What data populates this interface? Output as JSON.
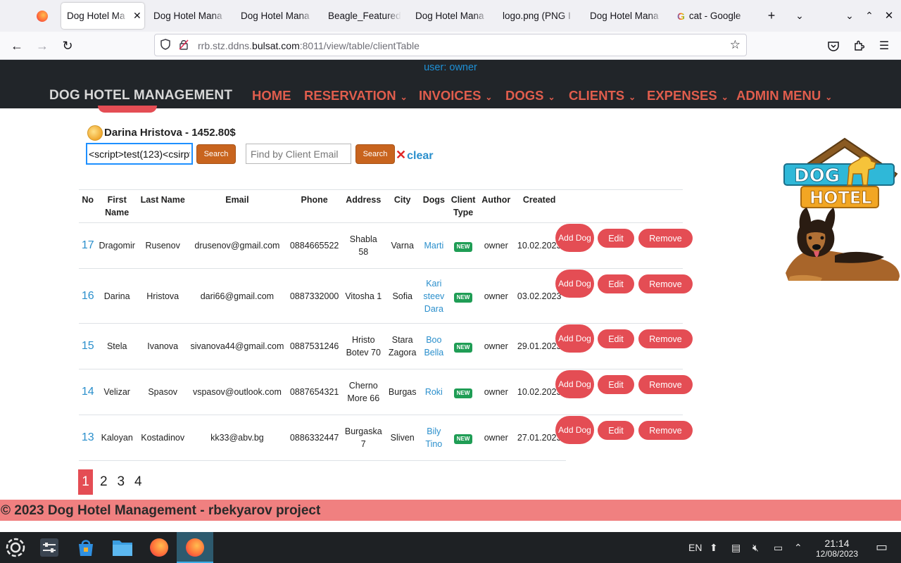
{
  "browser": {
    "tabs": [
      {
        "label": "Dog Hotel Ma",
        "active": true
      },
      {
        "label": "Dog Hotel Mana"
      },
      {
        "label": "Dog Hotel Mana"
      },
      {
        "label": "Beagle_Featured"
      },
      {
        "label": "Dog Hotel Mana"
      },
      {
        "label": "logo.png (PNG I"
      },
      {
        "label": "Dog Hotel Mana"
      },
      {
        "label": "cat - Google"
      }
    ],
    "url_prefix": "rrb.stz.ddns.",
    "url_domain": "bulsat.com",
    "url_suffix": ":8011/view/table/clientTable"
  },
  "header": {
    "user_line": "user: owner",
    "brand": "DOG HOTEL MANAGEMENT",
    "menu": {
      "home": "HOME",
      "reservation": "RESERVATION",
      "invoices": "INVOICES",
      "dogs": "DOGS",
      "clients": "CLIENTS",
      "expenses": "EXPENSES",
      "admin": "ADMIN MENU"
    },
    "accent_color": "#e05d4d"
  },
  "main": {
    "client_title": "Darina Hristova - 1452.80$",
    "search_value": "<script>test(123)<csirpt",
    "search_button": "Search",
    "email_placeholder": "Find by Client Email",
    "search_button2": "Search",
    "clear_x": "✕",
    "clear_label": "clear"
  },
  "table": {
    "headers": {
      "no": "No",
      "first_name": "First Name",
      "last_name": "Last Name",
      "email": "Email",
      "phone": "Phone",
      "address": "Address",
      "city": "City",
      "dogs": "Dogs",
      "client_type": "Client Type",
      "author": "Author",
      "created": "Created"
    },
    "rows": [
      {
        "no": "17",
        "first": "Dragomir",
        "last": "Rusenov",
        "email": "drusenov@gmail.com",
        "phone": "0884665522",
        "address": "Shabla 58",
        "city": "Varna",
        "dog1": "Marti",
        "dog2": "",
        "dog3": "",
        "type": "NEW",
        "author": "owner",
        "created": "10.02.2023"
      },
      {
        "no": "16",
        "first": "Darina",
        "last": "Hristova",
        "email": "dari66@gmail.com",
        "phone": "0887332000",
        "address": "Vitosha 1",
        "city": "Sofia",
        "dog1": "Kari",
        "dog2": "steev",
        "dog3": "Dara",
        "type": "NEW",
        "author": "owner",
        "created": "03.02.2023"
      },
      {
        "no": "15",
        "first": "Stela",
        "last": "Ivanova",
        "email": "sivanova44@gmail.com",
        "phone": "0887531246",
        "address": "Hristo Botev 70",
        "city": "Stara Zagora",
        "dog1": "Boo",
        "dog2": "Bella",
        "dog3": "",
        "type": "NEW",
        "author": "owner",
        "created": "29.01.2023"
      },
      {
        "no": "14",
        "first": "Velizar",
        "last": "Spasov",
        "email": "vspasov@outlook.com",
        "phone": "0887654321",
        "address": "Cherno More 66",
        "city": "Burgas",
        "dog1": "Roki",
        "dog2": "",
        "dog3": "",
        "type": "NEW",
        "author": "owner",
        "created": "10.02.2023"
      },
      {
        "no": "13",
        "first": "Kaloyan",
        "last": "Kostadinov",
        "email": "kk33@abv.bg",
        "phone": "0886332447",
        "address": "Burgaska 7",
        "city": "Sliven",
        "dog1": "Bily",
        "dog2": "Tino",
        "dog3": "",
        "type": "NEW",
        "author": "owner",
        "created": "27.01.2023"
      }
    ],
    "actions": {
      "add_dog": "Add Dog",
      "edit": "Edit",
      "remove": "Remove"
    }
  },
  "pager": {
    "pages": [
      "1",
      "2",
      "3",
      "4"
    ],
    "current": "1"
  },
  "footer": {
    "text": "© 2023 Dog Hotel Management - rbekyarov project"
  },
  "taskbar": {
    "lang": "EN",
    "time": "21:14",
    "date": "12/08/2023"
  }
}
